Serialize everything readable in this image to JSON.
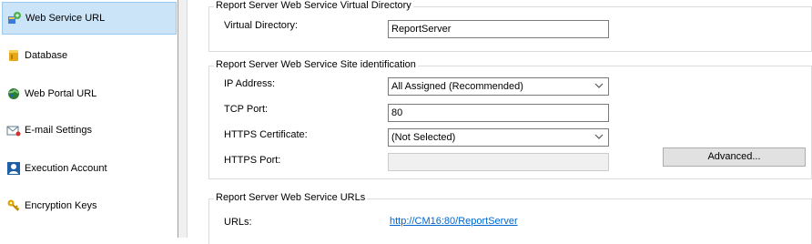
{
  "sidebar": {
    "items": [
      {
        "label": "Web Service URL",
        "icon": "web-service-icon",
        "selected": true
      },
      {
        "label": "Database",
        "icon": "database-icon"
      },
      {
        "label": "Web Portal URL",
        "icon": "globe-icon"
      },
      {
        "label": "E-mail Settings",
        "icon": "email-icon"
      },
      {
        "label": "Execution Account",
        "icon": "user-account-icon"
      },
      {
        "label": "Encryption Keys",
        "icon": "key-icon"
      }
    ]
  },
  "virtual_directory": {
    "title": "Report Server Web Service Virtual Directory",
    "label": "Virtual Directory:",
    "value": "ReportServer"
  },
  "site_identification": {
    "title": "Report Server Web Service Site identification",
    "ip_label": "IP Address:",
    "ip_value": "All Assigned (Recommended)",
    "tcp_label": "TCP Port:",
    "tcp_value": "80",
    "cert_label": "HTTPS Certificate:",
    "cert_value": "(Not Selected)",
    "https_label": "HTTPS Port:",
    "https_value": "",
    "advanced_label": "Advanced..."
  },
  "urls": {
    "title": "Report Server Web Service URLs",
    "label": "URLs:",
    "link": "http://CM16:80/ReportServer"
  },
  "colors": {
    "selection": "#cce4f7",
    "link": "#0066cc"
  }
}
